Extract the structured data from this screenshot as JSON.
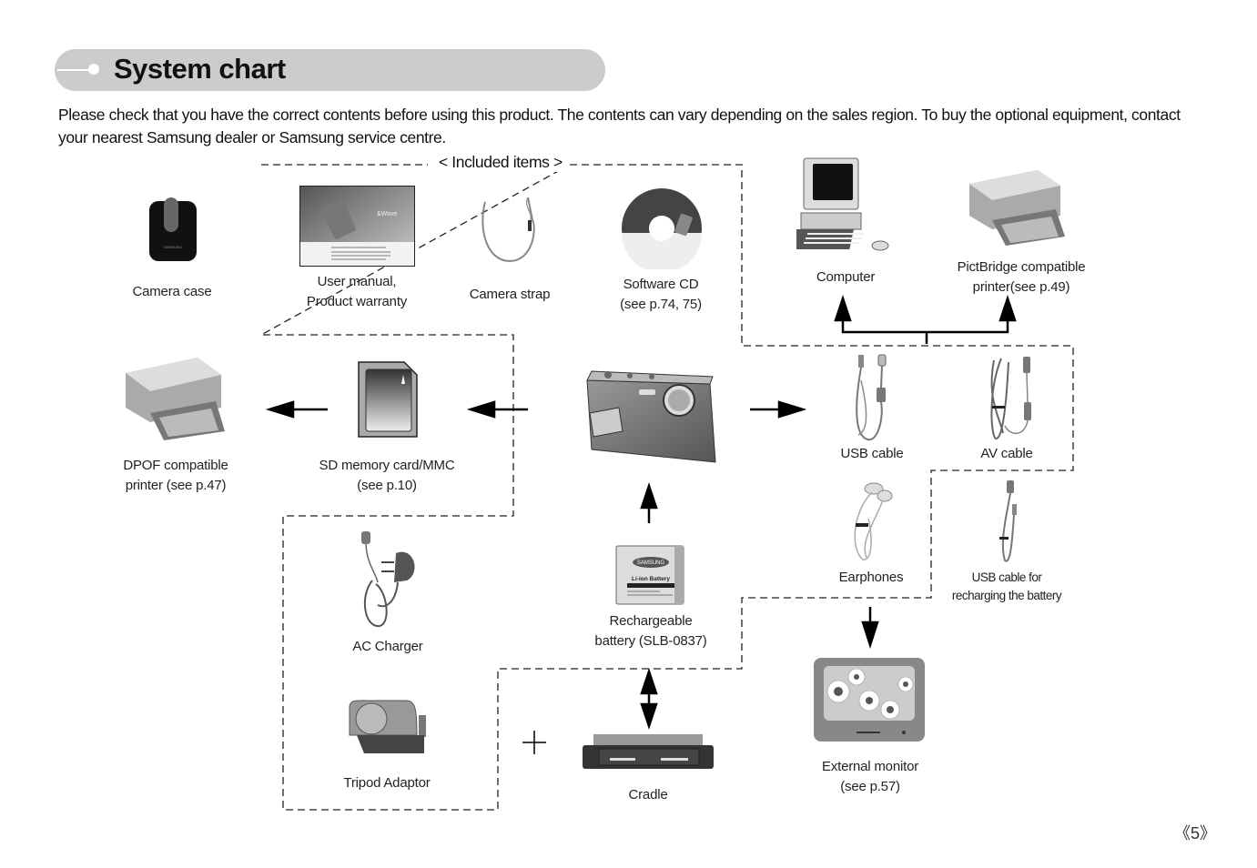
{
  "header": {
    "title": "System chart"
  },
  "intro": "Please check that you have the correct contents before using this product. The contents can vary depending on the sales region. To buy the optional equipment, contact your nearest Samsung dealer or Samsung service centre.",
  "included_group": {
    "title": "< Included items >"
  },
  "items": {
    "camera_case": {
      "label": "Camera case",
      "icon": "camera-case-icon"
    },
    "user_manual": {
      "label_line1": "User manual,",
      "label_line2": "Product warranty",
      "icon": "manual-icon"
    },
    "camera_strap": {
      "label": "Camera strap",
      "icon": "strap-icon"
    },
    "software_cd": {
      "label_line1": "Software CD",
      "label_line2": "(see p.74, 75)",
      "icon": "cd-icon"
    },
    "computer": {
      "label": "Computer",
      "icon": "computer-icon"
    },
    "pictbridge_printer": {
      "label_line1": "PictBridge compatible",
      "label_line2": "printer(see p.49)",
      "icon": "printer-icon"
    },
    "dpof_printer": {
      "label_line1": "DPOF compatible",
      "label_line2": "printer (see p.47)",
      "icon": "printer-icon"
    },
    "sd_card": {
      "label_line1": "SD memory card/MMC",
      "label_line2": "(see p.10)",
      "icon": "sd-card-icon"
    },
    "camera": {
      "icon": "camera-icon"
    },
    "usb_cable": {
      "label": "USB cable",
      "icon": "usb-cable-icon"
    },
    "av_cable": {
      "label": "AV cable",
      "icon": "av-cable-icon"
    },
    "earphones": {
      "label": "Earphones",
      "icon": "earphones-icon"
    },
    "usb_recharge_cable": {
      "label_line1": "USB cable for",
      "label_line2": "recharging the battery",
      "icon": "usb-cable-icon"
    },
    "ac_charger": {
      "label": "AC Charger",
      "icon": "ac-charger-icon"
    },
    "battery": {
      "label_line1": "Rechargeable",
      "label_line2": "battery (SLB-0837)",
      "icon": "battery-icon",
      "brand": "SAMSUNG",
      "type_text": "Li-ion Battery"
    },
    "tripod_adaptor": {
      "label": "Tripod Adaptor",
      "icon": "tripod-adaptor-icon"
    },
    "cradle": {
      "label": "Cradle",
      "icon": "cradle-icon"
    },
    "external_monitor": {
      "label_line1": "External monitor",
      "label_line2": "(see p.57)",
      "icon": "tv-icon"
    }
  },
  "plus_symbol": "+",
  "page_number": "《5》"
}
